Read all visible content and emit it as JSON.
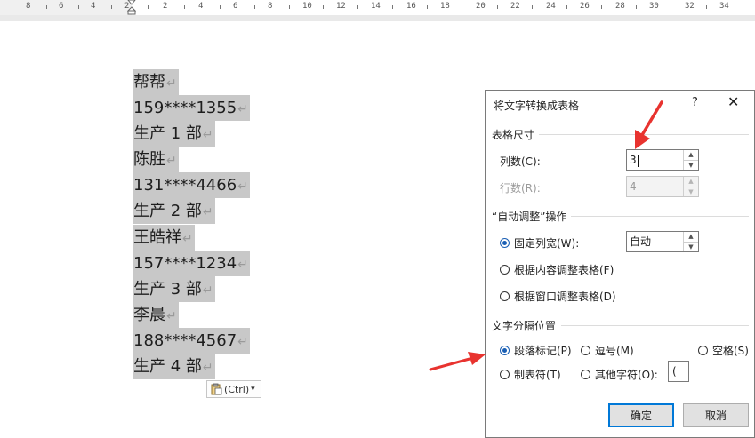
{
  "ruler": {
    "labels": [
      "8",
      "6",
      "4",
      "2",
      "2",
      "4",
      "6",
      "8",
      "10",
      "12",
      "14",
      "16",
      "18",
      "20",
      "22",
      "24",
      "26",
      "28",
      "30",
      "32",
      "34"
    ]
  },
  "document": {
    "lines": [
      "帮帮",
      "159****1355",
      "生产 1 部",
      "陈胜",
      "131****4466",
      "生产 2 部",
      "王皓祥",
      "157****1234",
      "生产 3 部",
      "李晨",
      "188****4567",
      "生产 4 部"
    ],
    "pilcrow": "↵",
    "paste_label": "(Ctrl)",
    "paste_dropdown": "▾"
  },
  "dialog": {
    "title": "将文字转换成表格",
    "help": "?",
    "close": "✕",
    "table_size": {
      "label": "表格尺寸",
      "columns_label": "列数(C):",
      "columns_value": "3",
      "rows_label": "行数(R):",
      "rows_value": "4"
    },
    "autofit": {
      "label": "“自动调整”操作",
      "fixed_label": "固定列宽(W):",
      "fixed_value": "自动",
      "content_label": "根据内容调整表格(F)",
      "window_label": "根据窗口调整表格(D)"
    },
    "separator": {
      "label": "文字分隔位置",
      "paragraph": "段落标记(P)",
      "comma": "逗号(M)",
      "space": "空格(S)",
      "tab": "制表符(T)",
      "other": "其他字符(O):",
      "other_value": "("
    },
    "ok": "确定",
    "cancel": "取消"
  },
  "colors": {
    "selection": "#c8c8c8",
    "arrow": "#e8332f",
    "accent": "#0078d7"
  }
}
